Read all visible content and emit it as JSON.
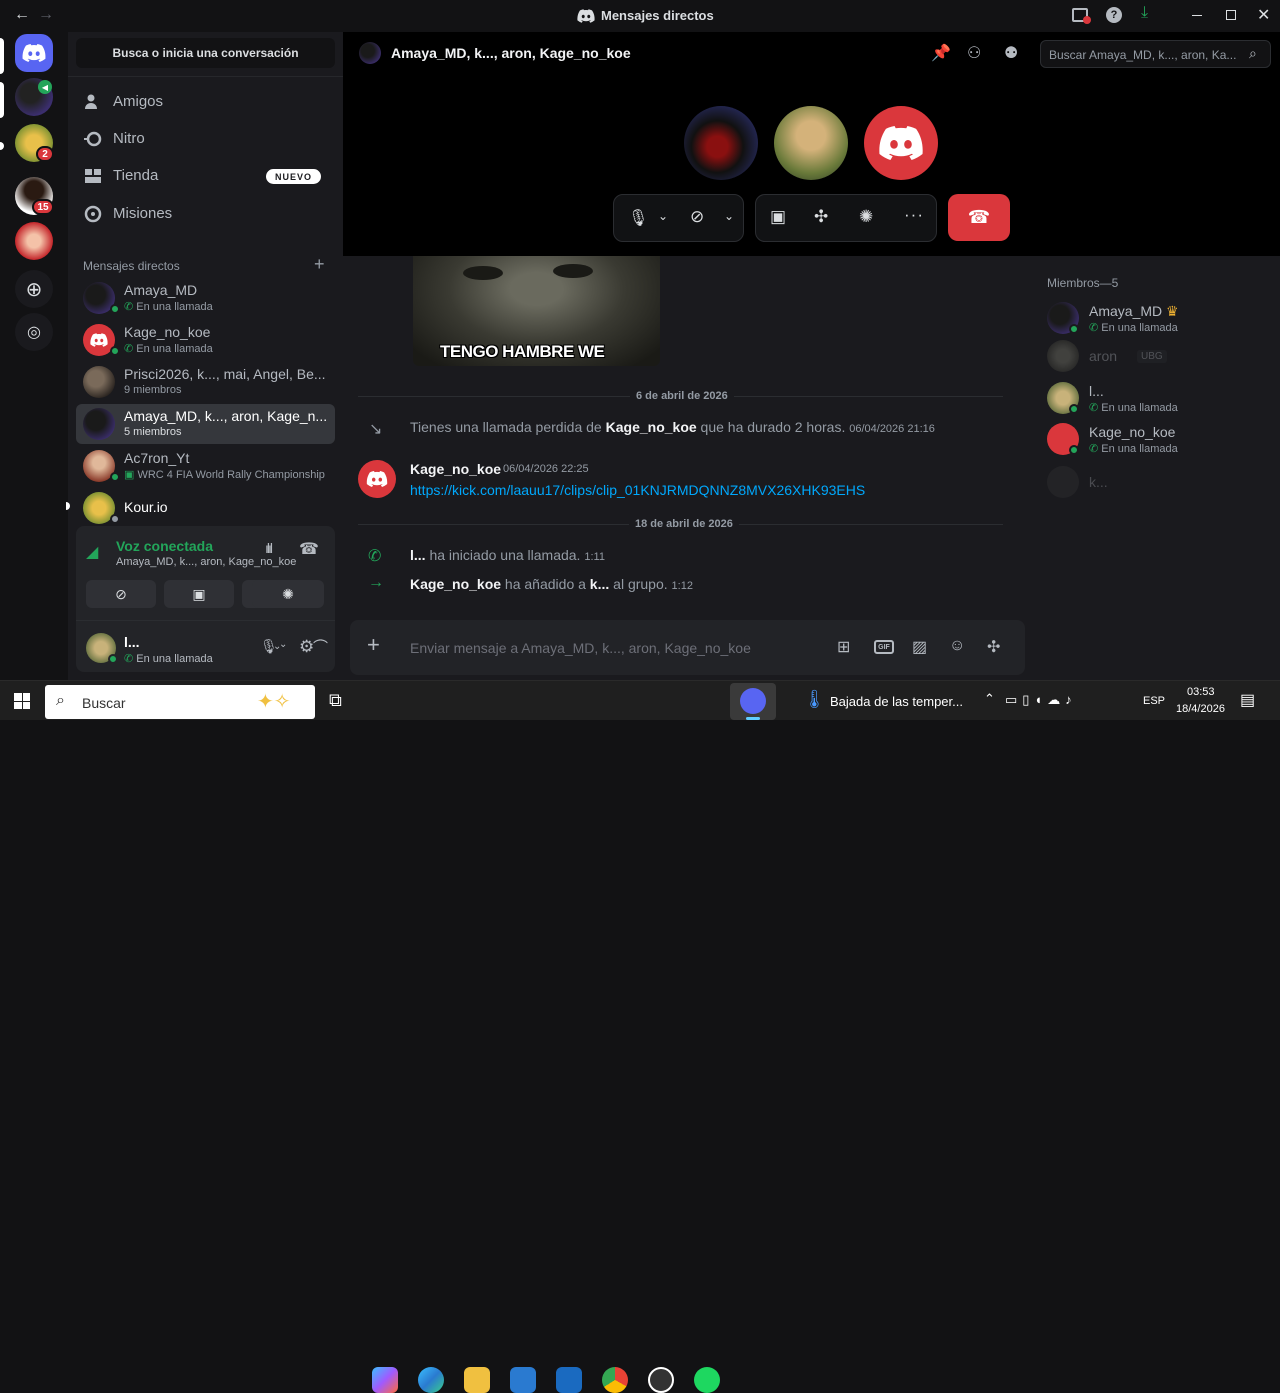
{
  "window": {
    "title": "Mensajes directos"
  },
  "guild_badges": [
    "2",
    "15"
  ],
  "sidebar": {
    "search_label": "Busca o inicia una conversación",
    "nav": [
      {
        "label": "Amigos",
        "icon": "friends-icon"
      },
      {
        "label": "Nitro",
        "icon": "nitro-icon"
      },
      {
        "label": "Tienda",
        "icon": "shop-icon",
        "badge": "NUEVO"
      },
      {
        "label": "Misiones",
        "icon": "quests-icon"
      }
    ],
    "dm_header": "Mensajes directos",
    "dms": [
      {
        "name": "Amaya_MD",
        "sub": "En una llamada"
      },
      {
        "name": "Kage_no_koe",
        "sub": "En una llamada"
      },
      {
        "name": "Prisci2026, k..., mai, Angel, Be...",
        "sub": "9 miembros"
      },
      {
        "name": "Amaya_MD, k..., aron, Kage_n...",
        "sub": "5 miembros"
      },
      {
        "name": "Ac7ron_Yt",
        "sub": "WRC 4 FIA World Rally Championship"
      },
      {
        "name": "Kour.io",
        "sub": ""
      }
    ]
  },
  "voice": {
    "status": "Voz conectada",
    "channel": "Amaya_MD, k..., aron, Kage_no_koe"
  },
  "user": {
    "name": "l...",
    "status": "En una llamada"
  },
  "header": {
    "title": "Amaya_MD, k..., aron, Kage_no_koe",
    "search_placeholder": "Buscar Amaya_MD, k..., aron, Ka..."
  },
  "meme_caption": "TENGO HAMBRE WE",
  "messages": {
    "divider1": "6 de abril de 2026",
    "missed_prefix": "Tienes una llamada perdida de ",
    "missed_user": "Kage_no_koe",
    "missed_suffix": " que ha durado 2 horas.",
    "missed_time": "06/04/2026 21:16",
    "author": "Kage_no_koe",
    "author_time": "06/04/2026 22:25",
    "link": "https://kick.com/laauu17/clips/clip_01KNJRMDQNNZ8MVX26XHK93EHS",
    "divider2": "18 de abril de 2026",
    "call_user": "l...",
    "call_text": " ha iniciado una llamada.",
    "call_time": "1:11",
    "add_user": "Kage_no_koe",
    "add_mid": " ha añadido a ",
    "add_target": "k...",
    "add_suffix": " al grupo.",
    "add_time": "1:12"
  },
  "composer": {
    "placeholder": "Enviar mensaje a Amaya_MD, k..., aron, Kage_no_koe"
  },
  "members": {
    "header": "Miembros—5",
    "list": [
      {
        "name": "Amaya_MD",
        "sub": "En una llamada"
      },
      {
        "name": "aron",
        "sub": "UBG"
      },
      {
        "name": "l...",
        "sub": "En una llamada"
      },
      {
        "name": "Kage_no_koe",
        "sub": "En una llamada"
      },
      {
        "name": "k...",
        "sub": ""
      }
    ]
  },
  "taskbar": {
    "search": "Buscar",
    "weather": "Bajada de las temper...",
    "lang": "ESP",
    "time": "03:53",
    "date": "18/4/2026"
  },
  "colors": {
    "brand": "#5865f2",
    "danger": "#da373c",
    "online": "#23a55a",
    "link": "#00a8fc"
  }
}
